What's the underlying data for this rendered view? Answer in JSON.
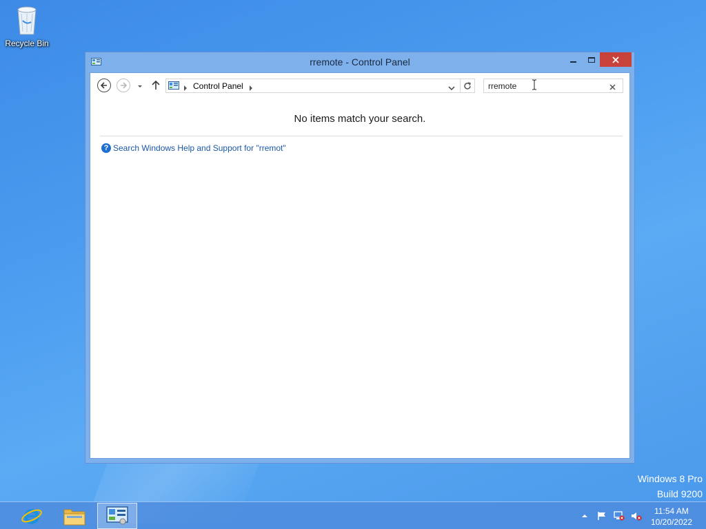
{
  "desktop": {
    "recycle_bin_label": "Recycle Bin",
    "watermark_line1": "Windows 8 Pro",
    "watermark_line2": "Build 9200"
  },
  "window": {
    "title": "rremote - Control Panel",
    "address": {
      "breadcrumb": "Control Panel"
    },
    "search": {
      "value": "rremote"
    },
    "content": {
      "no_items_message": "No items match your search.",
      "help_link": "Search Windows Help and Support for \"rremot\""
    }
  },
  "taskbar": {
    "pinned": [
      {
        "name": "Internet Explorer",
        "icon": "ie-icon"
      },
      {
        "name": "File Explorer",
        "icon": "folder-icon"
      },
      {
        "name": "Control Panel",
        "icon": "control-panel-icon",
        "active": true
      }
    ],
    "clock": {
      "time": "11:54 AM",
      "date": "10/20/2022"
    }
  },
  "colors": {
    "close_button": "#c8413a",
    "link": "#1c57a8",
    "window_frame": "#7eb0ec"
  }
}
